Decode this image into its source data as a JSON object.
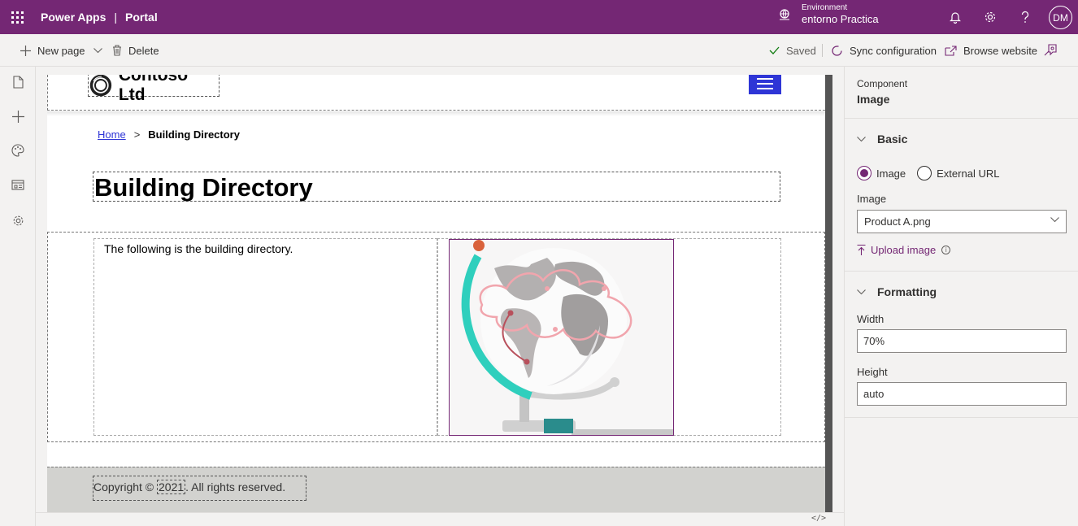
{
  "brand_color": "#742774",
  "accent_color": "#2e35d6",
  "topbar": {
    "app_name": "Power Apps",
    "separator": "|",
    "portal": "Portal",
    "environment_label": "Environment",
    "environment_value": "entorno Practica",
    "avatar_initials": "DM",
    "icons": [
      "waffle-icon",
      "environment-icon",
      "bell-icon",
      "gear-icon",
      "help-icon"
    ]
  },
  "commandbar": {
    "new_page": "New page",
    "delete": "Delete",
    "status": "Saved",
    "sync": "Sync configuration",
    "browse": "Browse website"
  },
  "rail": {
    "icons": [
      "pages-icon",
      "add-component-icon",
      "theme-icon",
      "templates-icon",
      "settings-icon"
    ]
  },
  "site": {
    "logo_text": "Contoso Ltd",
    "breadcrumb_home": "Home",
    "breadcrumb_sep": ">",
    "breadcrumb_current": "Building Directory",
    "title": "Building Directory",
    "body_text": "The following is the building directory.",
    "footer_prefix": "Copyright ©",
    "footer_year": "2021",
    "footer_suffix": ". All rights reserved."
  },
  "code_toggle": "</>",
  "panel": {
    "component_label": "Component",
    "component_name": "Image",
    "basic_header": "Basic",
    "radio_image": "Image",
    "radio_external": "External URL",
    "image_label": "Image",
    "image_value": "Product A.png",
    "upload_label": "Upload image",
    "info_glyph": "i",
    "formatting_header": "Formatting",
    "width_label": "Width",
    "width_value": "70%",
    "height_label": "Height",
    "height_value": "auto"
  }
}
